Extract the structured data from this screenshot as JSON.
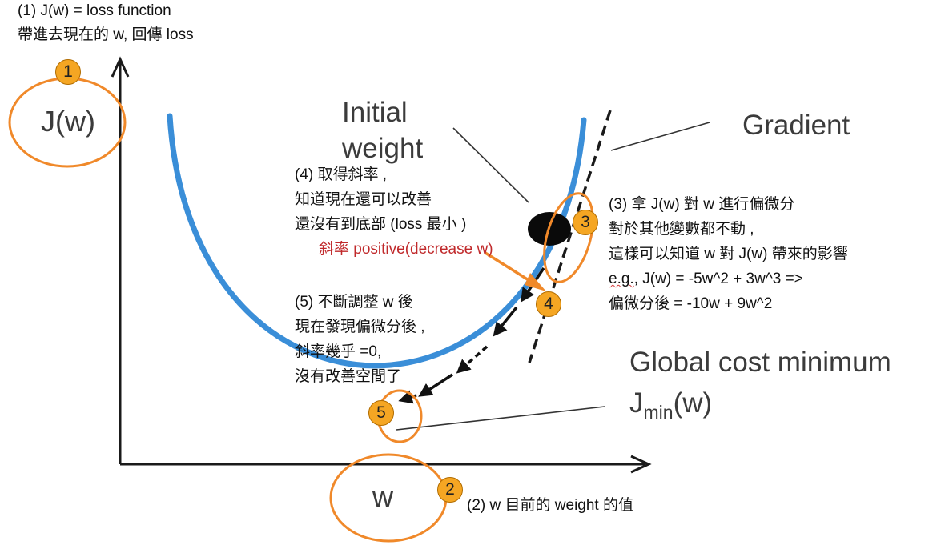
{
  "colors": {
    "curve": "#3a8ed8",
    "axis": "#1a1a1a",
    "highlight": "#f0892a",
    "badge_fill": "#f5a623",
    "ball": "#0a0a0a",
    "annotation_red": "#c0292b"
  },
  "figure": {
    "y_axis_label": "J(w)",
    "x_axis_label": "w",
    "initial_weight_label": [
      "Initial",
      "weight"
    ],
    "gradient_label": "Gradient",
    "global_min_label": "Global cost minimum",
    "jmin_label": {
      "base": "J",
      "sub": "min",
      "suffix": "(w)"
    }
  },
  "notes": {
    "note1": [
      "(1) J(w) = loss function",
      "帶進去現在的 w, 回傳 loss"
    ],
    "note2": "(2) w 目前的 weight 的值",
    "note3": {
      "line1": "(3)  拿 J(w) 對 w 進行偏微分",
      "line2": "對於其他變數都不動 ,",
      "line3": "這樣可以知道 w 對 J(w) 帶來的影響",
      "line4_eg": "e.g.",
      "line4_rest": ", J(w) = -5w^2 + 3w^3 =>",
      "line5": "偏微分後  = -10w + 9w^2"
    },
    "note4": {
      "line1": "(4)  取得斜率 ,",
      "line2": "知道現在還可以改善",
      "line3": "還沒有到底部 (loss 最小 )",
      "line4_red": "斜率 positive(decrease w)"
    },
    "note5": [
      "(5)  不斷調整 w 後",
      "現在發現偏微分後 ,",
      "斜率幾乎 =0,",
      "沒有改善空間了"
    ]
  },
  "badges": [
    "1",
    "2",
    "3",
    "4",
    "5"
  ]
}
